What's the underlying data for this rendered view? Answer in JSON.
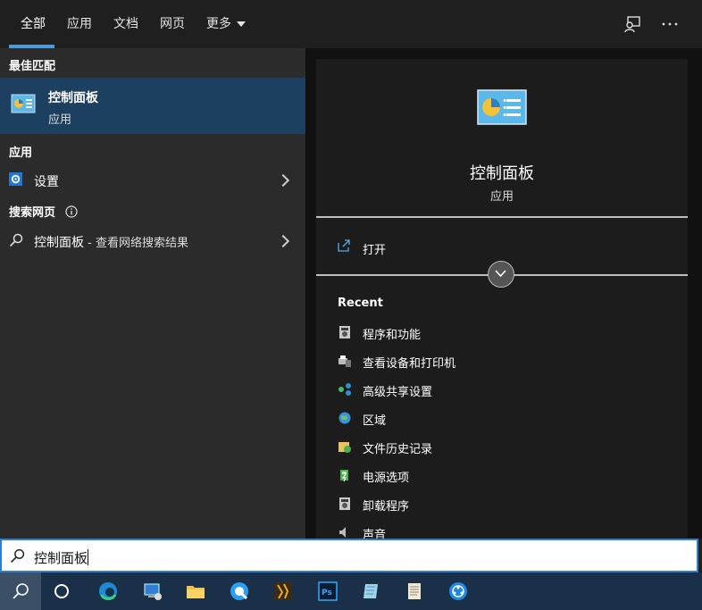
{
  "tabs": {
    "all": "全部",
    "apps": "应用",
    "docs": "文档",
    "web": "网页",
    "more": "更多"
  },
  "left": {
    "best_match_header": "最佳匹配",
    "best_match": {
      "title": "控制面板",
      "subtitle": "应用"
    },
    "apps_header": "应用",
    "settings_label": "设置",
    "search_web_header": "搜索网页",
    "web_result": {
      "query": "控制面板",
      "suffix": " - 查看网络搜索结果"
    }
  },
  "right": {
    "title": "控制面板",
    "subtitle": "应用",
    "open_label": "打开",
    "recent_header": "Recent",
    "recent": [
      {
        "label": "程序和功能",
        "icon": "programs-icon"
      },
      {
        "label": "查看设备和打印机",
        "icon": "devices-printers-icon"
      },
      {
        "label": "高级共享设置",
        "icon": "network-sharing-icon"
      },
      {
        "label": "区域",
        "icon": "region-globe-icon"
      },
      {
        "label": "文件历史记录",
        "icon": "file-history-icon"
      },
      {
        "label": "电源选项",
        "icon": "power-options-icon"
      },
      {
        "label": "卸载程序",
        "icon": "uninstall-icon"
      },
      {
        "label": "声音",
        "icon": "sound-icon"
      }
    ]
  },
  "search": {
    "value": "控制面板"
  },
  "colors": {
    "accent": "#4c9bd8",
    "selected": "#1d3f60",
    "taskbar": "#1a2f48"
  }
}
